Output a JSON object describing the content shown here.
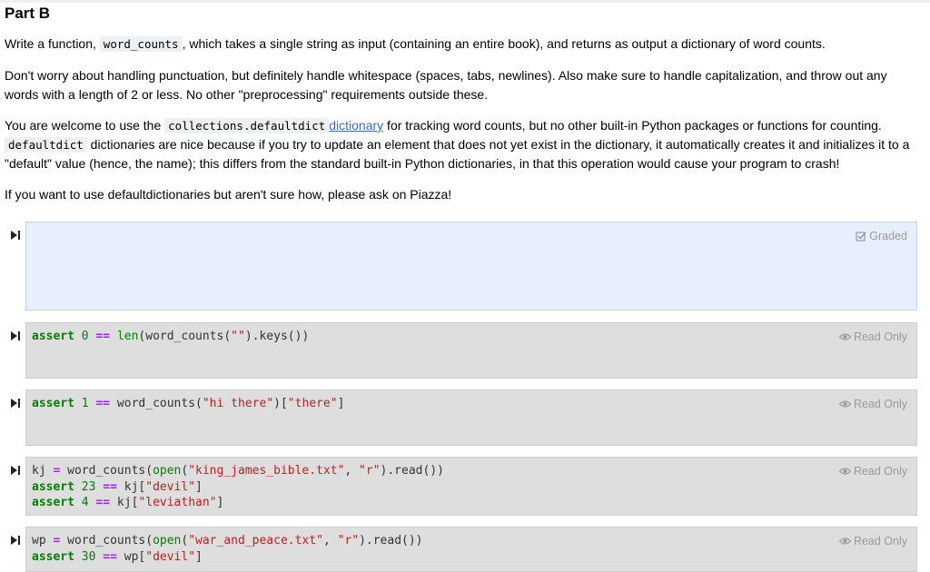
{
  "section": {
    "title": "Part B"
  },
  "p1": {
    "a": "Write a function, ",
    "code": "word_counts",
    "b": ", which takes a single string as input (containing an entire book), and returns as output a dictionary of word counts."
  },
  "p2": {
    "text": "Don't worry about handling punctuation, but definitely handle whitespace (spaces, tabs, newlines). Also make sure to handle capitalization, and throw out any words with a length of 2 or less. No other \"preprocessing\" requirements outside these."
  },
  "p3": {
    "a": "You are welcome to use the ",
    "code1": "collections.defaultdict",
    "link": "dictionary",
    "b": " for tracking word counts, but no other built-in Python packages or functions for counting. ",
    "code2": "defaultdict",
    "c": " dictionaries are nice because if you try to update an element that does not yet exist in the dictionary, it automatically creates it and initializes it to a \"default\" value (hence, the name); this differs from the standard built-in Python dictionaries, in that this operation would cause your program to crash!"
  },
  "p4": {
    "text": "If you want to use defaultdictionaries but aren't sure how, please ask on Piazza!"
  },
  "badges": {
    "graded": "Graded",
    "read_only": "Read Only"
  },
  "icons": {
    "run": "run-cell-icon",
    "graded": "checkbox-icon",
    "read_only": "eye-icon"
  },
  "colors": {
    "answer_cell_bg": "#e7effc",
    "readonly_cell_bg": "#dedede",
    "keyword": "#008000",
    "string": "#ba2121",
    "operator": "#aa22ff",
    "link": "#3f6ab5"
  },
  "cells": [
    {
      "type": "answer",
      "badge": "Graded",
      "code": ""
    },
    {
      "type": "test",
      "badge": "Read Only",
      "tokens": [
        [
          "kw",
          "assert"
        ],
        [
          "",
          " "
        ],
        [
          "num",
          "0"
        ],
        [
          "",
          " "
        ],
        [
          "op",
          "=="
        ],
        [
          "",
          " "
        ],
        [
          "bi",
          "len"
        ],
        [
          "",
          "(word_counts("
        ],
        [
          "str",
          "\"\""
        ],
        [
          "",
          ").keys())"
        ]
      ]
    },
    {
      "type": "test",
      "badge": "Read Only",
      "tokens": [
        [
          "kw",
          "assert"
        ],
        [
          "",
          " "
        ],
        [
          "num",
          "1"
        ],
        [
          "",
          " "
        ],
        [
          "op",
          "=="
        ],
        [
          "",
          " word_counts("
        ],
        [
          "str",
          "\"hi there\""
        ],
        [
          "",
          ")["
        ],
        [
          "str",
          "\"there\""
        ],
        [
          "",
          "]"
        ]
      ]
    },
    {
      "type": "test",
      "badge": "Read Only",
      "tokens": [
        [
          "",
          "kj "
        ],
        [
          "op",
          "="
        ],
        [
          "",
          " word_counts("
        ],
        [
          "bi",
          "open"
        ],
        [
          "",
          "("
        ],
        [
          "str",
          "\"king_james_bible.txt\""
        ],
        [
          "",
          ", "
        ],
        [
          "str",
          "\"r\""
        ],
        [
          "",
          ").read())\n"
        ],
        [
          "kw",
          "assert"
        ],
        [
          "",
          " "
        ],
        [
          "num",
          "23"
        ],
        [
          "",
          " "
        ],
        [
          "op",
          "=="
        ],
        [
          "",
          " kj["
        ],
        [
          "str",
          "\"devil\""
        ],
        [
          "",
          "]\n"
        ],
        [
          "kw",
          "assert"
        ],
        [
          "",
          " "
        ],
        [
          "num",
          "4"
        ],
        [
          "",
          " "
        ],
        [
          "op",
          "=="
        ],
        [
          "",
          " kj["
        ],
        [
          "str",
          "\"leviathan\""
        ],
        [
          "",
          "]"
        ]
      ]
    },
    {
      "type": "test",
      "badge": "Read Only",
      "tokens": [
        [
          "",
          "wp "
        ],
        [
          "op",
          "="
        ],
        [
          "",
          " word_counts("
        ],
        [
          "bi",
          "open"
        ],
        [
          "",
          "("
        ],
        [
          "str",
          "\"war_and_peace.txt\""
        ],
        [
          "",
          ", "
        ],
        [
          "str",
          "\"r\""
        ],
        [
          "",
          ").read())\n"
        ],
        [
          "kw",
          "assert"
        ],
        [
          "",
          " "
        ],
        [
          "num",
          "30"
        ],
        [
          "",
          " "
        ],
        [
          "op",
          "=="
        ],
        [
          "",
          " wp["
        ],
        [
          "str",
          "\"devil\""
        ],
        [
          "",
          "]"
        ]
      ]
    }
  ]
}
